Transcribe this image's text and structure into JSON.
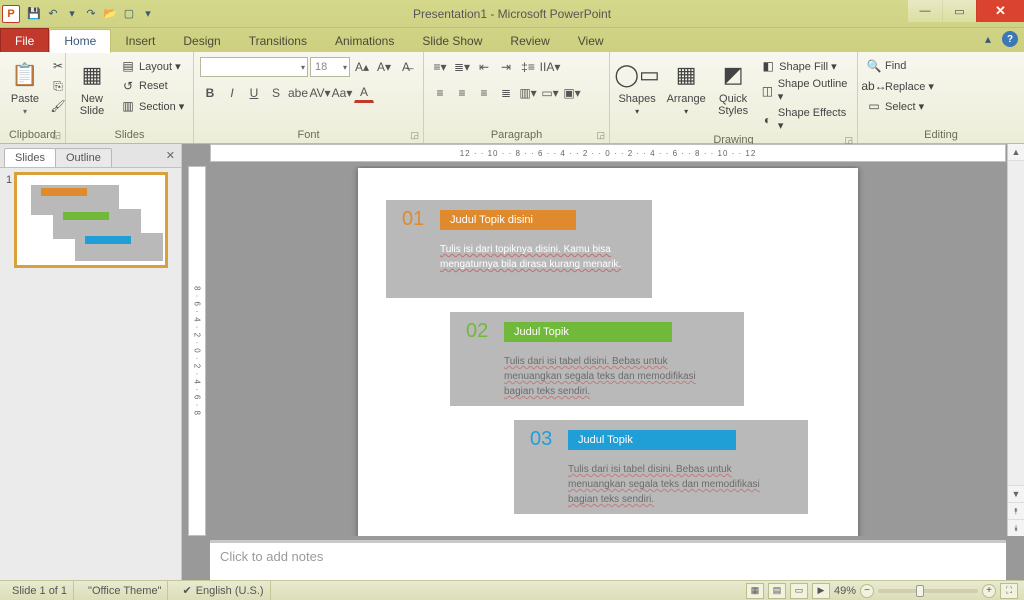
{
  "title": "Presentation1 - Microsoft PowerPoint",
  "qat": {
    "save": "💾",
    "undo": "↶",
    "redo": "↷",
    "open": "📂",
    "new": "▢",
    "dd": "▾"
  },
  "tabs": {
    "file": "File",
    "home": "Home",
    "insert": "Insert",
    "design": "Design",
    "transitions": "Transitions",
    "animations": "Animations",
    "slideshow": "Slide Show",
    "review": "Review",
    "view": "View"
  },
  "ribbon": {
    "clipboard": {
      "label": "Clipboard",
      "paste": "Paste"
    },
    "slides": {
      "label": "Slides",
      "newslide": "New\nSlide",
      "layout": "Layout ▾",
      "reset": "Reset",
      "section": "Section ▾"
    },
    "font": {
      "label": "Font",
      "family_ph": "",
      "size": "18"
    },
    "paragraph": {
      "label": "Paragraph"
    },
    "drawing": {
      "label": "Drawing",
      "shapes": "Shapes",
      "arrange": "Arrange",
      "quick": "Quick\nStyles",
      "fill": "Shape Fill ▾",
      "outline": "Shape Outline ▾",
      "effects": "Shape Effects ▾"
    },
    "editing": {
      "label": "Editing",
      "find": "Find",
      "replace": "Replace ▾",
      "select": "Select ▾"
    }
  },
  "pane": {
    "slides_tab": "Slides",
    "outline_tab": "Outline",
    "num": "1"
  },
  "rulerH": "12 · · 10 · · 8 · · 6 · · 4 · · 2 · · 0 · · 2 · · 4 · · 6 · · 8 · · 10 · · 12",
  "rulerV": "8 · 6 · 4 · 2 · 0 · 2 · 4 · 6 · 8",
  "slide": {
    "c1": {
      "num": "01",
      "title": "Judul Topik disini",
      "body": "Tulis isi dari topiknya disini. Kamu bisa mengaturnya bila dirasa kurang menarik."
    },
    "c2": {
      "num": "02",
      "title": "Judul Topik",
      "body": "Tulis dari isi tabel disini. Bebas untuk menuangkan segala teks dan memodifikasi bagian teks sendiri."
    },
    "c3": {
      "num": "03",
      "title": "Judul Topik",
      "body": "Tulis dari isi tabel disini. Bebas untuk menuangkan segala teks dan memodifikasi bagian teks sendiri."
    }
  },
  "notes_ph": "Click to add notes",
  "status": {
    "slide": "Slide 1 of 1",
    "theme": "\"Office Theme\"",
    "lang": "English (U.S.)",
    "zoom": "49%"
  },
  "colors": {
    "c1": "#e08a2e",
    "c2": "#71b93a",
    "c3": "#1f9fd6"
  }
}
